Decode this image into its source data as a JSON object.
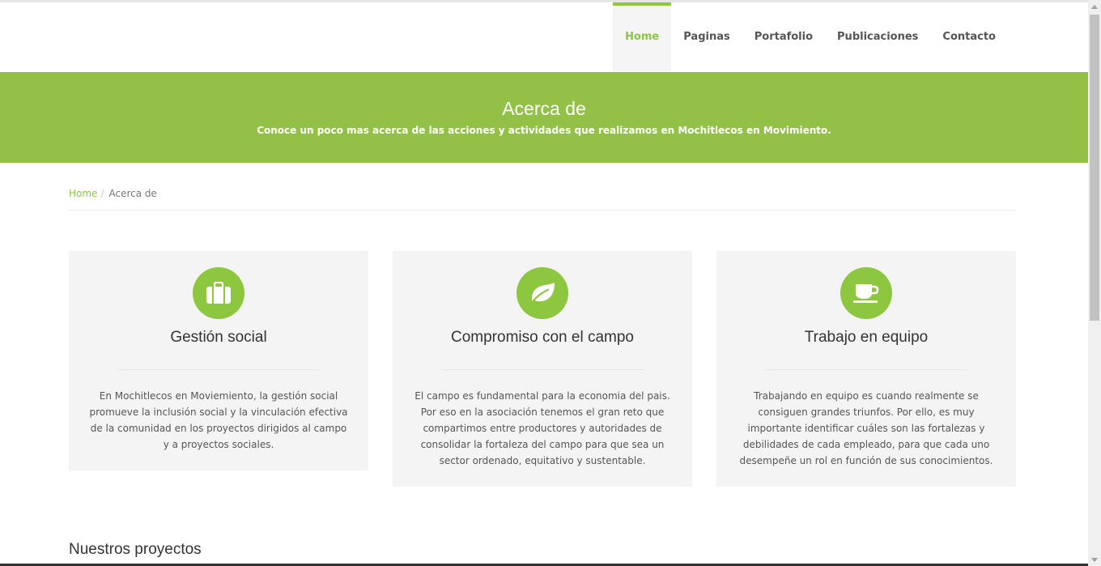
{
  "nav": {
    "items": [
      {
        "label": "Home",
        "active": true
      },
      {
        "label": "Paginas",
        "active": false
      },
      {
        "label": "Portafolio",
        "active": false
      },
      {
        "label": "Publicaciones",
        "active": false
      },
      {
        "label": "Contacto",
        "active": false
      }
    ]
  },
  "banner": {
    "title": "Acerca de",
    "subtitle": "Conoce un poco mas acerca de las acciones y actividades que realizamos en Mochitlecos en Movimiento."
  },
  "breadcrumb": {
    "home": "Home",
    "separator": "/",
    "current": "Acerca de"
  },
  "cards": [
    {
      "icon": "briefcase-icon",
      "title": "Gestión social",
      "text": "En Mochitlecos en Moviemiento, la gestión social promueve la inclusión social y la vinculación efectiva de la comunidad en los proyectos dirigidos al campo y a proyectos sociales."
    },
    {
      "icon": "leaf-icon",
      "title": "Compromiso con el campo",
      "text": "El campo es fundamental para la economia del pais. Por eso en la asociación tenemos el gran reto que compartimos entre productores y autoridades de consolidar la fortaleza del campo para que sea un sector ordenado, equitativo y sustentable."
    },
    {
      "icon": "coffee-icon",
      "title": "Trabajo en equipo",
      "text": "Trabajando en equipo es cuando realmente se consiguen grandes triunfos. Por ello, es muy importante identificar cuáles son las fortalezas y debilidades de cada empleado, para que cada uno desempeñe un rol en función de sus conocimientos."
    }
  ],
  "projects": {
    "title": "Nuestros proyectos"
  },
  "colors": {
    "accent": "#8dc63f",
    "banner": "#93c147",
    "card_bg": "#f4f4f4"
  }
}
